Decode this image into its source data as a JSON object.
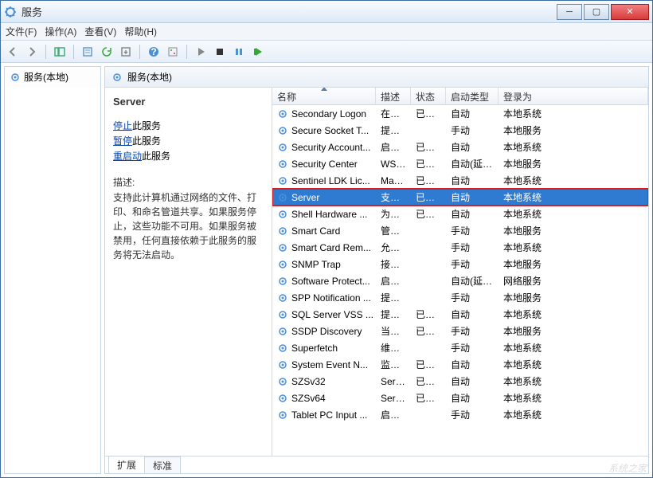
{
  "window": {
    "title": "服务"
  },
  "menu": {
    "file": "文件(F)",
    "action": "操作(A)",
    "view": "查看(V)",
    "help": "帮助(H)"
  },
  "left": {
    "root": "服务(本地)"
  },
  "right_header": "服务(本地)",
  "detail": {
    "title": "Server",
    "link_stop": "停止",
    "link_stop_suffix": "此服务",
    "link_pause": "暂停",
    "link_pause_suffix": "此服务",
    "link_restart": "重启动",
    "link_restart_suffix": "此服务",
    "desc_label": "描述:",
    "desc": "支持此计算机通过网络的文件、打印、和命名管道共享。如果服务停止，这些功能不可用。如果服务被禁用，任何直接依赖于此服务的服务将无法启动。"
  },
  "columns": {
    "name": "名称",
    "desc": "描述",
    "status": "状态",
    "startup": "启动类型",
    "logon": "登录为"
  },
  "rows": [
    {
      "name": "Secondary Logon",
      "desc": "在不...",
      "status": "已启动",
      "startup": "自动",
      "logon": "本地系统"
    },
    {
      "name": "Secure Socket T...",
      "desc": "提供...",
      "status": "",
      "startup": "手动",
      "logon": "本地服务"
    },
    {
      "name": "Security Account...",
      "desc": "启动...",
      "status": "已启动",
      "startup": "自动",
      "logon": "本地系统"
    },
    {
      "name": "Security Center",
      "desc": "WSC...",
      "status": "已启动",
      "startup": "自动(延迟...",
      "logon": "本地服务"
    },
    {
      "name": "Sentinel LDK Lic...",
      "desc": "Man...",
      "status": "已启动",
      "startup": "自动",
      "logon": "本地系统"
    },
    {
      "name": "Server",
      "desc": "支持...",
      "status": "已启动",
      "startup": "自动",
      "logon": "本地系统",
      "selected": true
    },
    {
      "name": "Shell Hardware ...",
      "desc": "为自...",
      "status": "已启动",
      "startup": "自动",
      "logon": "本地系统"
    },
    {
      "name": "Smart Card",
      "desc": "管理...",
      "status": "",
      "startup": "手动",
      "logon": "本地服务"
    },
    {
      "name": "Smart Card Rem...",
      "desc": "允许...",
      "status": "",
      "startup": "手动",
      "logon": "本地系统"
    },
    {
      "name": "SNMP Trap",
      "desc": "接收...",
      "status": "",
      "startup": "手动",
      "logon": "本地服务"
    },
    {
      "name": "Software Protect...",
      "desc": "启用 ...",
      "status": "",
      "startup": "自动(延迟...",
      "logon": "网络服务"
    },
    {
      "name": "SPP Notification ...",
      "desc": "提供...",
      "status": "",
      "startup": "手动",
      "logon": "本地服务"
    },
    {
      "name": "SQL Server VSS ...",
      "desc": "提供...",
      "status": "已启动",
      "startup": "自动",
      "logon": "本地系统"
    },
    {
      "name": "SSDP Discovery",
      "desc": "当发...",
      "status": "已启动",
      "startup": "手动",
      "logon": "本地服务"
    },
    {
      "name": "Superfetch",
      "desc": "维护...",
      "status": "",
      "startup": "手动",
      "logon": "本地系统"
    },
    {
      "name": "System Event N...",
      "desc": "监视...",
      "status": "已启动",
      "startup": "自动",
      "logon": "本地系统"
    },
    {
      "name": "SZSv32",
      "desc": "Servi...",
      "status": "已启动",
      "startup": "自动",
      "logon": "本地系统"
    },
    {
      "name": "SZSv64",
      "desc": "Servi...",
      "status": "已启动",
      "startup": "自动",
      "logon": "本地系统"
    },
    {
      "name": "Tablet PC Input ...",
      "desc": "启用 ...",
      "status": "",
      "startup": "手动",
      "logon": "本地系统"
    }
  ],
  "tabs": {
    "extended": "扩展",
    "standard": "标准"
  },
  "watermark": "系统之家"
}
